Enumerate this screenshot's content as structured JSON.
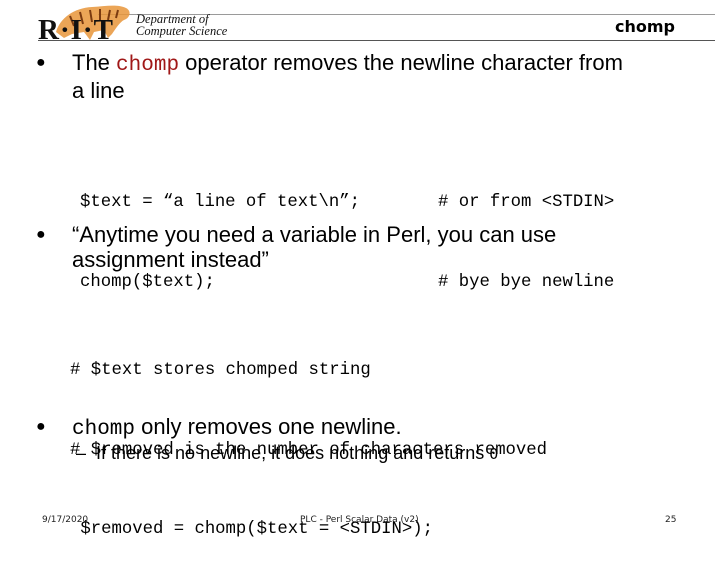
{
  "header": {
    "logo_letters": "R·I·T",
    "department_line1": "Department of",
    "department_line2": "Computer Science",
    "slide_title": "chomp"
  },
  "bullets": [
    {
      "prefix": "The ",
      "code": "chomp",
      "suffix_line1": " operator removes the newline character from",
      "line2": "a line"
    },
    {
      "line1": "“Anytime you need a variable in Perl, you can use",
      "line2": "assignment instead”"
    },
    {
      "code": "chomp",
      "suffix": " only removes one newline."
    }
  ],
  "code_block_1": {
    "lines": [
      {
        "code": "$text = “a line of text\\n”;",
        "comment": "# or from <STDIN>"
      },
      {
        "code": "chomp($text);",
        "comment": "# bye bye newline"
      }
    ]
  },
  "code_block_2": {
    "lines": [
      "# $text stores chomped string",
      "# $removed is the number of characters removed",
      " $removed = chomp($text = <STDIN>);"
    ]
  },
  "sub_bullet": {
    "dash": "–",
    "text": "If there is no newline, it does nothing and returns ",
    "value": "0"
  },
  "footer": {
    "date": "9/17/2020",
    "title": "PLC - Perl Scalar Data (v2)",
    "page": "25"
  }
}
